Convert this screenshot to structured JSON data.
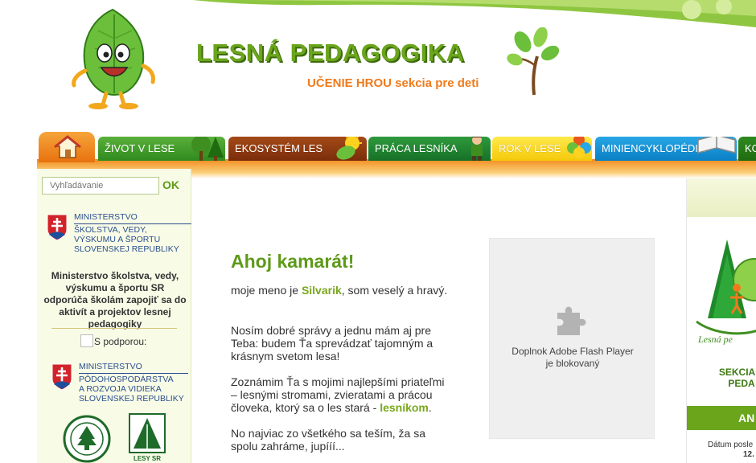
{
  "header": {
    "title": "LESNÁ PEDAGOGIKA",
    "subtitle": "UČENIE HROU sekcia pre deti"
  },
  "nav": {
    "tabs": [
      {
        "label": "ŽIVOT V LESE"
      },
      {
        "label": "EKOSYSTÉM LES"
      },
      {
        "label": "PRÁCA LESNÍKA"
      },
      {
        "label": "ROK V LESE"
      },
      {
        "label": "MINIENCYKLOPÉDIA"
      },
      {
        "label": "KO"
      }
    ]
  },
  "search": {
    "placeholder": "Vyhľadávanie",
    "button_label": "OK"
  },
  "sidebar": {
    "ministry_lines": [
      "MINISTERSTVO",
      "ŠKOLSTVA, VEDY,",
      "VÝSKUMU A ŠPORTU",
      "SLOVENSKEJ REPUBLIKY"
    ],
    "ministry_desc": "Ministerstvo školstva, vedy, výskumu a športu SR odporúča školám zapojiť sa do aktivít a projektov lesnej pedagogiky",
    "support_label": "S podporou:",
    "agri_lines": [
      "MINISTERSTVO",
      "PÔDOHOSPODÁRSTVA",
      "A ROZVOJA VIDIEKA",
      "SLOVENSKEJ REPUBLIKY"
    ],
    "lesy_label": "LESY SR"
  },
  "main": {
    "greeting": "Ahoj kamarát!",
    "p1_a": "moje meno je ",
    "p1_name": "Silvarik",
    "p1_b": ", som veselý a hravý.",
    "p2": "Nosím dobré správy a jednu mám aj pre Teba: budem Ťa sprevádzať tajomným a krásnym svetom lesa!",
    "p3_a": " Zoznámim Ťa s mojimi najlepšími priateľmi – lesnými stromami, zvieratami a prácou človeka, ktorý sa o les stará - ",
    "p3_link": "lesníkom",
    "p3_b": ".",
    "p4": "No najviac zo všetkého sa teším, ža sa spolu zahráme, jupííí..."
  },
  "flash": {
    "line1": "Doplnok Adobe Flash Player",
    "line2": "je blokovaný"
  },
  "right": {
    "logo_text": "Lesná pe",
    "section_line1": "SEKCIA P",
    "section_line2": "PEDA",
    "bar_label": "AN",
    "date_label": "Dátum posle",
    "date_value": "12."
  },
  "colors": {
    "accent_green": "#6aa51c",
    "orange": "#f07a1b",
    "ministry_blue": "#2a4f8f"
  }
}
